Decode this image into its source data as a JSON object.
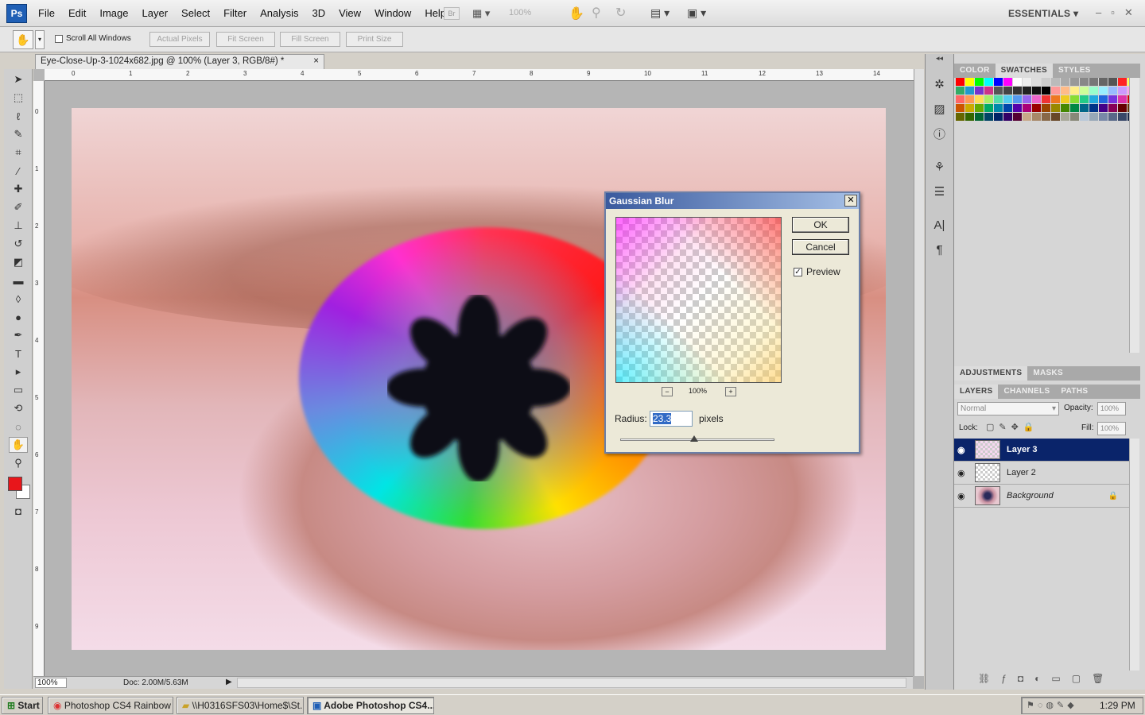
{
  "app": {
    "logo": "Ps"
  },
  "menu": [
    "File",
    "Edit",
    "Image",
    "Layer",
    "Select",
    "Filter",
    "Analysis",
    "3D",
    "View",
    "Window",
    "Help"
  ],
  "menubar_extras": {
    "bridge": "Br",
    "zoom": "100%",
    "workspace": "ESSENTIALS"
  },
  "options": {
    "scroll_all_windows": "Scroll All Windows",
    "buttons": [
      "Actual Pixels",
      "Fit Screen",
      "Fill Screen",
      "Print Size"
    ]
  },
  "document": {
    "tab_title": "Eye-Close-Up-3-1024x682.jpg @ 100% (Layer 3, RGB/8#) *",
    "close": "×"
  },
  "ruler": {
    "top": [
      "0",
      "1",
      "2",
      "3",
      "4",
      "5",
      "6",
      "7",
      "8",
      "9",
      "10",
      "11",
      "12",
      "13",
      "14"
    ],
    "left": [
      "0",
      "1",
      "2",
      "3",
      "4",
      "5",
      "6",
      "7",
      "8",
      "9"
    ]
  },
  "dialog": {
    "title": "Gaussian Blur",
    "ok": "OK",
    "cancel": "Cancel",
    "preview_label": "Preview",
    "preview_checked": true,
    "zoom": "100%",
    "zoom_out": "−",
    "zoom_in": "+",
    "radius_label": "Radius:",
    "radius_value": "23.3",
    "units": "pixels"
  },
  "panels": {
    "top_tabs": [
      "COLOR",
      "SWATCHES",
      "STYLES"
    ],
    "mid_tabs": [
      "ADJUSTMENTS",
      "MASKS"
    ],
    "layer_tabs": [
      "LAYERS",
      "CHANNELS",
      "PATHS"
    ],
    "blend_mode": "Normal",
    "opacity_label": "Opacity:",
    "opacity": "100%",
    "lock_label": "Lock:",
    "fill_label": "Fill:",
    "fill": "100%",
    "layers": [
      {
        "name": "Layer 3",
        "selected": true
      },
      {
        "name": "Layer 2",
        "selected": false
      },
      {
        "name": "Background",
        "selected": false,
        "locked": true
      }
    ]
  },
  "status": {
    "zoom": "100%",
    "doc": "Doc: 2.00M/5.63M"
  },
  "taskbar": {
    "start": "Start",
    "tasks": [
      "Photoshop CS4 Rainbow ...",
      "\\\\H0316SFS03\\Home$\\St...",
      "Adobe Photoshop CS4..."
    ],
    "clock": "1:29 PM"
  },
  "colors": {
    "accent": "#0a246a",
    "foreground_swatch": "#e8161b",
    "background_swatch": "#ffffff"
  }
}
